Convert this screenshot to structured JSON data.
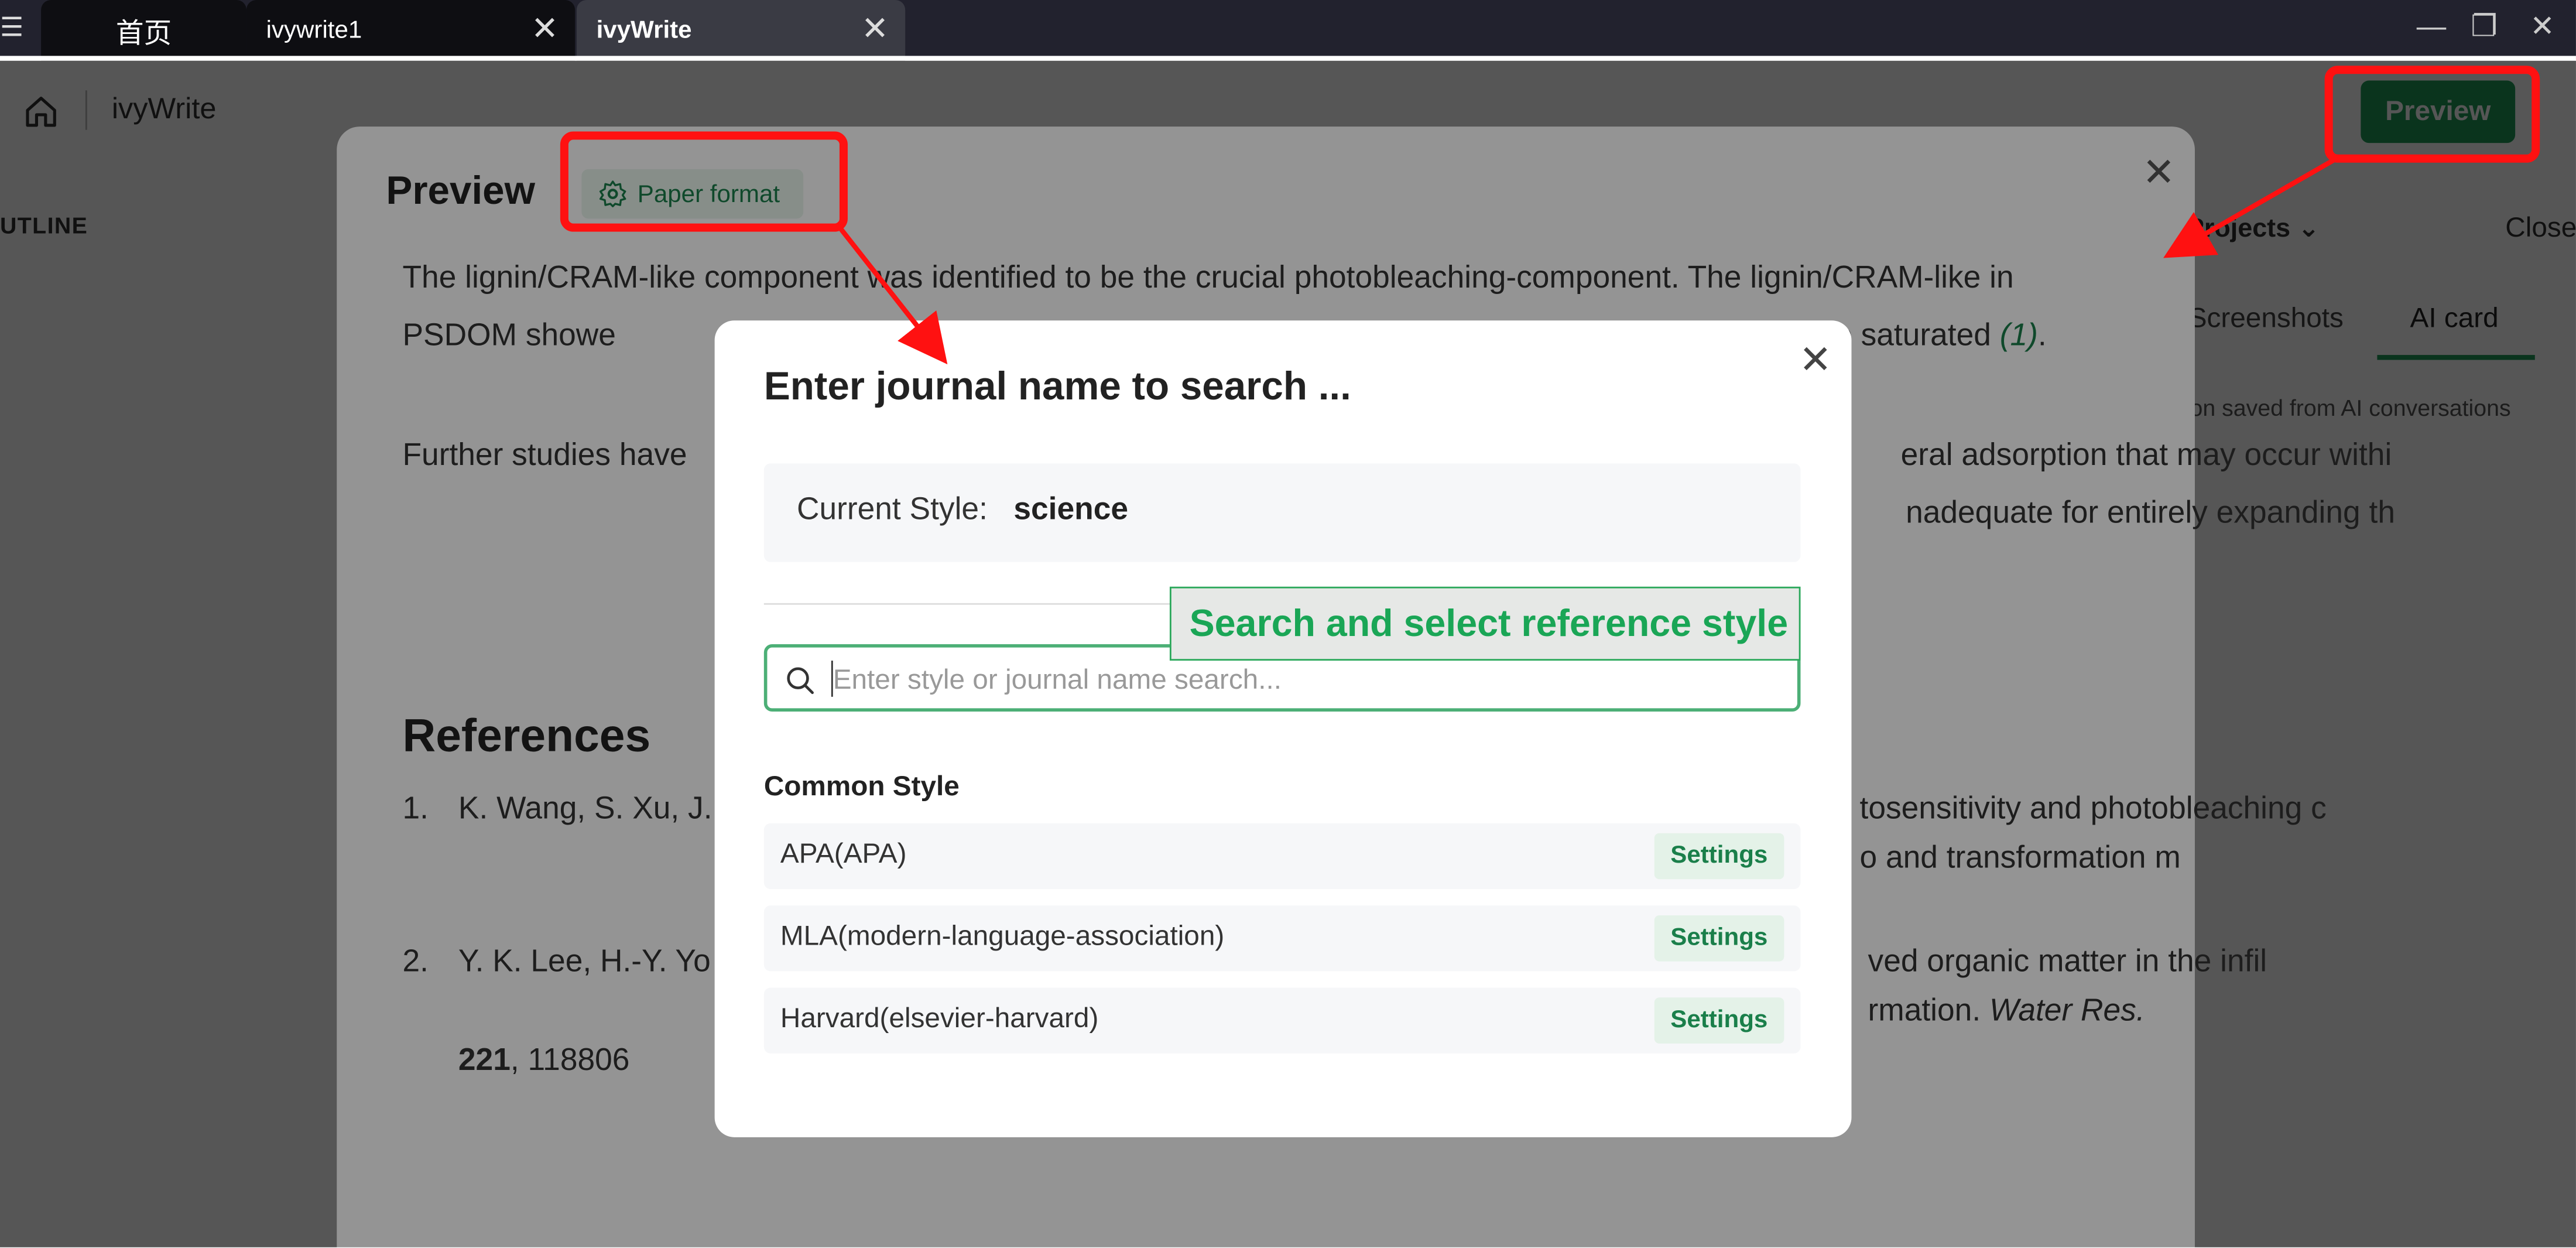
{
  "titlebar": {
    "tabs": [
      {
        "label": "首页"
      },
      {
        "label": "ivywrite1"
      },
      {
        "label": "ivyWrite"
      }
    ]
  },
  "app": {
    "title": "ivyWrite",
    "preview_button": "Preview",
    "outline_label": "UTLINE",
    "projects_label": "Projects",
    "close_label": "Close",
    "tabs": [
      "Screenshots",
      "AI card"
    ],
    "right_hint": "on saved from AI conversations"
  },
  "preview": {
    "title": "Preview",
    "format_button": "Paper format",
    "para1_a": "The lignin/CRAM-like component was identified to be the crucial photobleaching-component. The lignin/CRAM-like in PSDOM showe",
    "para1_b": "m unsaturated to saturated ",
    "para1_cite": "(1)",
    "para1_end": ".",
    "para2_a": "Further studies have",
    "para2_b": "eral adsorption that may occur withi",
    "para2_c": "nadequate for entirely expanding th",
    "references_title": "References",
    "references": [
      {
        "num": "1.",
        "text_a": "K. Wang, S. Xu, J.",
        "text_b": "tosensitivity and photobleaching c",
        "text_c": "o and transformation m"
      },
      {
        "num": "2.",
        "text_a": "Y. K. Lee, H.-Y. Yo",
        "text_b": "ved organic matter in the infil",
        "text_c": "rmation. ",
        "journal": "Water Res.",
        "volume": "221",
        "pages": ", 118806"
      }
    ]
  },
  "modal": {
    "title": "Enter journal name to search ...",
    "current_style_label": "Current Style:",
    "current_style_value": "science",
    "search_placeholder": "Enter style or journal name search...",
    "common_style_label": "Common Style",
    "styles": [
      {
        "name": "APA(APA)",
        "action": "Settings"
      },
      {
        "name": "MLA(modern-language-association)",
        "action": "Settings"
      },
      {
        "name": "Harvard(elsevier-harvard)",
        "action": "Settings"
      }
    ]
  },
  "annotation": {
    "callout": "Search and select reference style"
  },
  "colors": {
    "accent": "#1f9c57",
    "highlight": "#ff1111"
  }
}
